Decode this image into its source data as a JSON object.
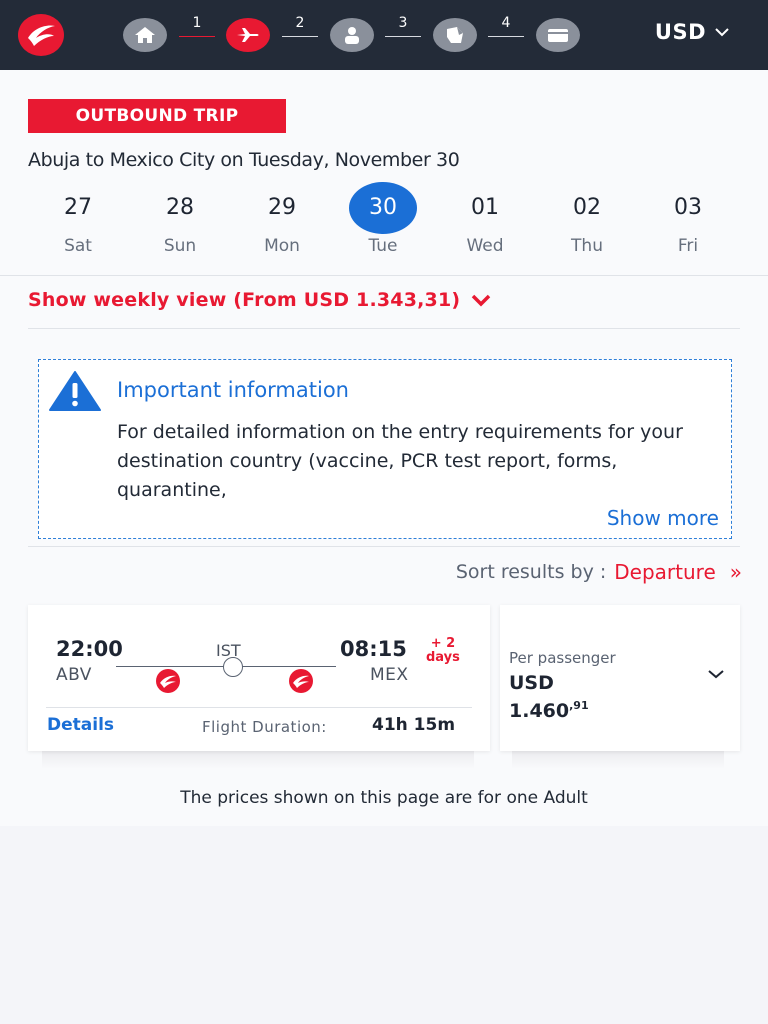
{
  "header": {
    "steps": [
      {
        "icon": "home-icon",
        "number": ""
      },
      {
        "icon": "airplane-icon",
        "number": "1"
      },
      {
        "icon": "passenger-icon",
        "number": "2"
      },
      {
        "icon": "seat-icon",
        "number": "3"
      },
      {
        "icon": "payment-card-icon",
        "number": "4"
      }
    ],
    "currency": "USD"
  },
  "trip": {
    "badge": "OUTBOUND TRIP",
    "route": "Abuja to Mexico City on Tuesday, November 30"
  },
  "dates": [
    {
      "day": "27",
      "weekday": "Sat"
    },
    {
      "day": "28",
      "weekday": "Sun"
    },
    {
      "day": "29",
      "weekday": "Mon"
    },
    {
      "day": "30",
      "weekday": "Tue",
      "selected": true
    },
    {
      "day": "01",
      "weekday": "Wed"
    },
    {
      "day": "02",
      "weekday": "Thu"
    },
    {
      "day": "03",
      "weekday": "Fri"
    }
  ],
  "weekly_view": "Show weekly view (From USD 1.343,31)",
  "info": {
    "title": "Important information",
    "body": "For detailed information on the entry requirements for your destination country (vaccine, PCR test report, forms, quarantine,",
    "show_more": "Show more"
  },
  "sort": {
    "label": "Sort results by :",
    "value": "Departure",
    "arrow": "»"
  },
  "flight": {
    "departure_time": "22:00",
    "departure_code": "ABV",
    "via": "IST",
    "arrival_time": "08:15",
    "arrival_code": "MEX",
    "plus_days_line1": "+ 2",
    "plus_days_line2": "days",
    "details": "Details",
    "duration_label": "Flight Duration:",
    "duration": "41h 15m",
    "per_passenger": "Per passenger",
    "currency": "USD",
    "price_main": "1.460",
    "price_decimal": ",91"
  },
  "footer_note": "The prices shown on this page are for one Adult",
  "colors": {
    "header_bg": "#232b38",
    "brand_red": "#e81932",
    "accent_blue": "#1b6fd6"
  }
}
